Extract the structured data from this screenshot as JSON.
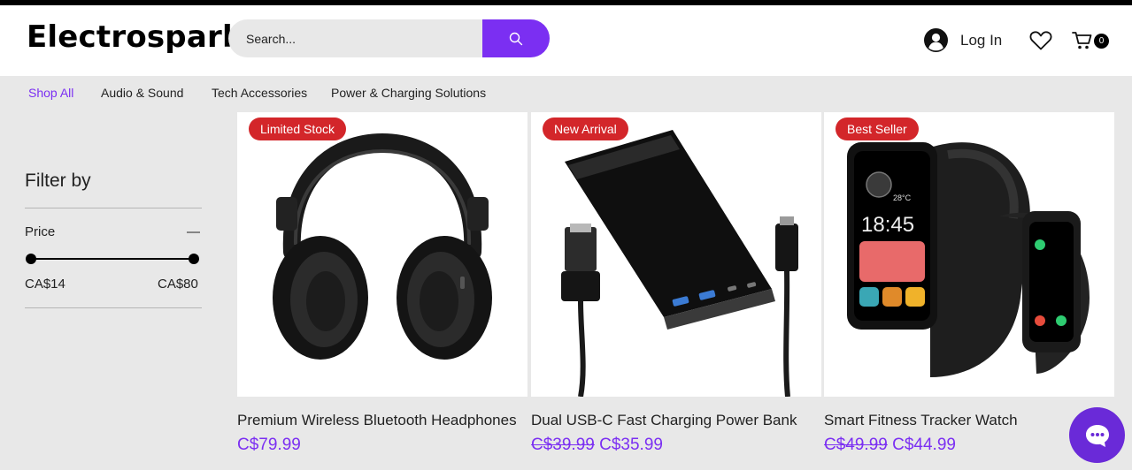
{
  "header": {
    "logo": "Electrospark",
    "search_placeholder": "Search...",
    "login_label": "Log In",
    "cart_count": "0"
  },
  "nav": {
    "items": [
      {
        "label": "Shop All",
        "active": true
      },
      {
        "label": "Audio & Sound",
        "active": false
      },
      {
        "label": "Tech Accessories",
        "active": false
      },
      {
        "label": "Power & Charging Solutions",
        "active": false
      }
    ]
  },
  "filters": {
    "title": "Filter by",
    "price": {
      "label": "Price",
      "toggle": "—",
      "min": "CA$14",
      "max": "CA$80"
    }
  },
  "products": [
    {
      "ribbon": "Limited Stock",
      "name": "Premium Wireless Bluetooth Headphones",
      "old_price": "",
      "price": "C$79.99"
    },
    {
      "ribbon": "New Arrival",
      "name": "Dual USB-C Fast Charging Power Bank",
      "old_price": "C$39.99",
      "price": "C$35.99"
    },
    {
      "ribbon": "Best Seller",
      "name": "Smart Fitness Tracker Watch",
      "old_price": "C$49.99",
      "price": "C$44.99"
    }
  ],
  "watch_screen": {
    "time": "18:45"
  },
  "colors": {
    "accent": "#7b2ff2",
    "ribbon": "#d3262a",
    "chat": "#6a2ad8"
  }
}
